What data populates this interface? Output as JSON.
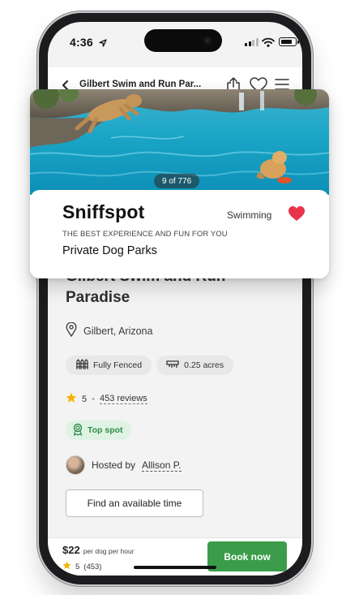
{
  "status_bar": {
    "time": "4:36"
  },
  "app_bar": {
    "title": "Gilbert Swim and Run Par..."
  },
  "listing": {
    "title": "Gilbert Swim and Run Paradise",
    "location": "Gilbert, Arizona",
    "amenities": [
      "Fully Fenced",
      "0.25 acres"
    ],
    "rating": "5",
    "reviews": "453 reviews",
    "badge": "Top spot",
    "hosted_by_label": "Hosted by",
    "host_name": "Allison P.",
    "find_time_label": "Find an available time"
  },
  "booking_bar": {
    "price": "$22",
    "price_unit": "per dog per hour",
    "rating": "5",
    "review_count": "(453)",
    "book_label": "Book now",
    "accent_color": "#3b9d4a"
  },
  "card": {
    "photo_counter": "9 of 776",
    "brand": "Sniffspot",
    "activity": "Swimming",
    "tagline": "THE BEST EXPERIENCE AND FUN FOR YOU",
    "category": "Private Dog Parks",
    "favorite_color": "#e8334a"
  }
}
